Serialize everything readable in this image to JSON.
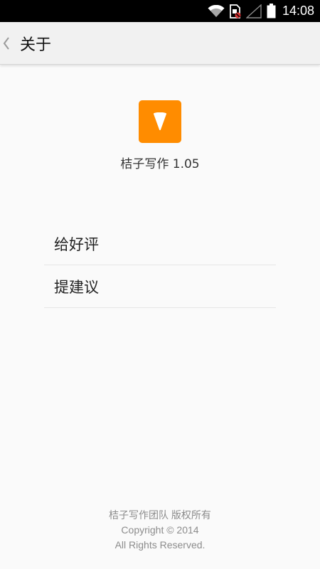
{
  "status_bar": {
    "time": "14:08",
    "icons": [
      "wifi-icon",
      "sim-card-icon",
      "signal-icon",
      "battery-icon"
    ]
  },
  "action_bar": {
    "back_icon": "chevron-left-icon",
    "title": "关于"
  },
  "app": {
    "icon": "app-logo-icon",
    "icon_color": "#ff8c00",
    "name_version": "桔子写作 1.05"
  },
  "menu": {
    "items": [
      {
        "label": "给好评"
      },
      {
        "label": "提建议"
      }
    ]
  },
  "footer": {
    "team": "桔子写作团队 版权所有",
    "copyright": "Copyright © 2014",
    "rights": "All Rights Reserved."
  }
}
